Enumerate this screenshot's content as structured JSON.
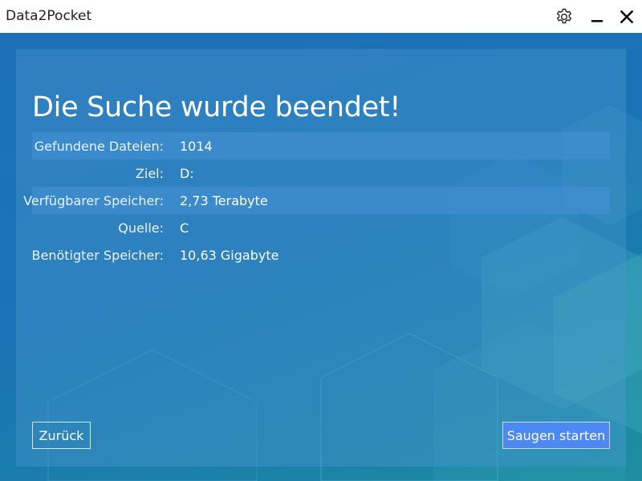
{
  "window": {
    "title": "Data2Pocket",
    "controls": {
      "settings_icon": "gear-icon",
      "minimize_icon": "minimize-icon",
      "close_icon": "close-icon"
    }
  },
  "main": {
    "heading": "Die Suche wurde beendet!",
    "rows": [
      {
        "label": "Gefundene Dateien:",
        "value": "1014"
      },
      {
        "label": "Ziel:",
        "value": "D:"
      },
      {
        "label": "Verfügbarer Speicher:",
        "value": "2,73 Terabyte"
      },
      {
        "label": "Quelle:",
        "value": "C"
      },
      {
        "label": "Benötigter Speicher:",
        "value": "10,63 Gigabyte"
      }
    ],
    "back_button": "Zurück",
    "start_button": "Saugen starten"
  },
  "colors": {
    "background_blue": "#1a73b5",
    "accent_button": "#4d89f2"
  }
}
